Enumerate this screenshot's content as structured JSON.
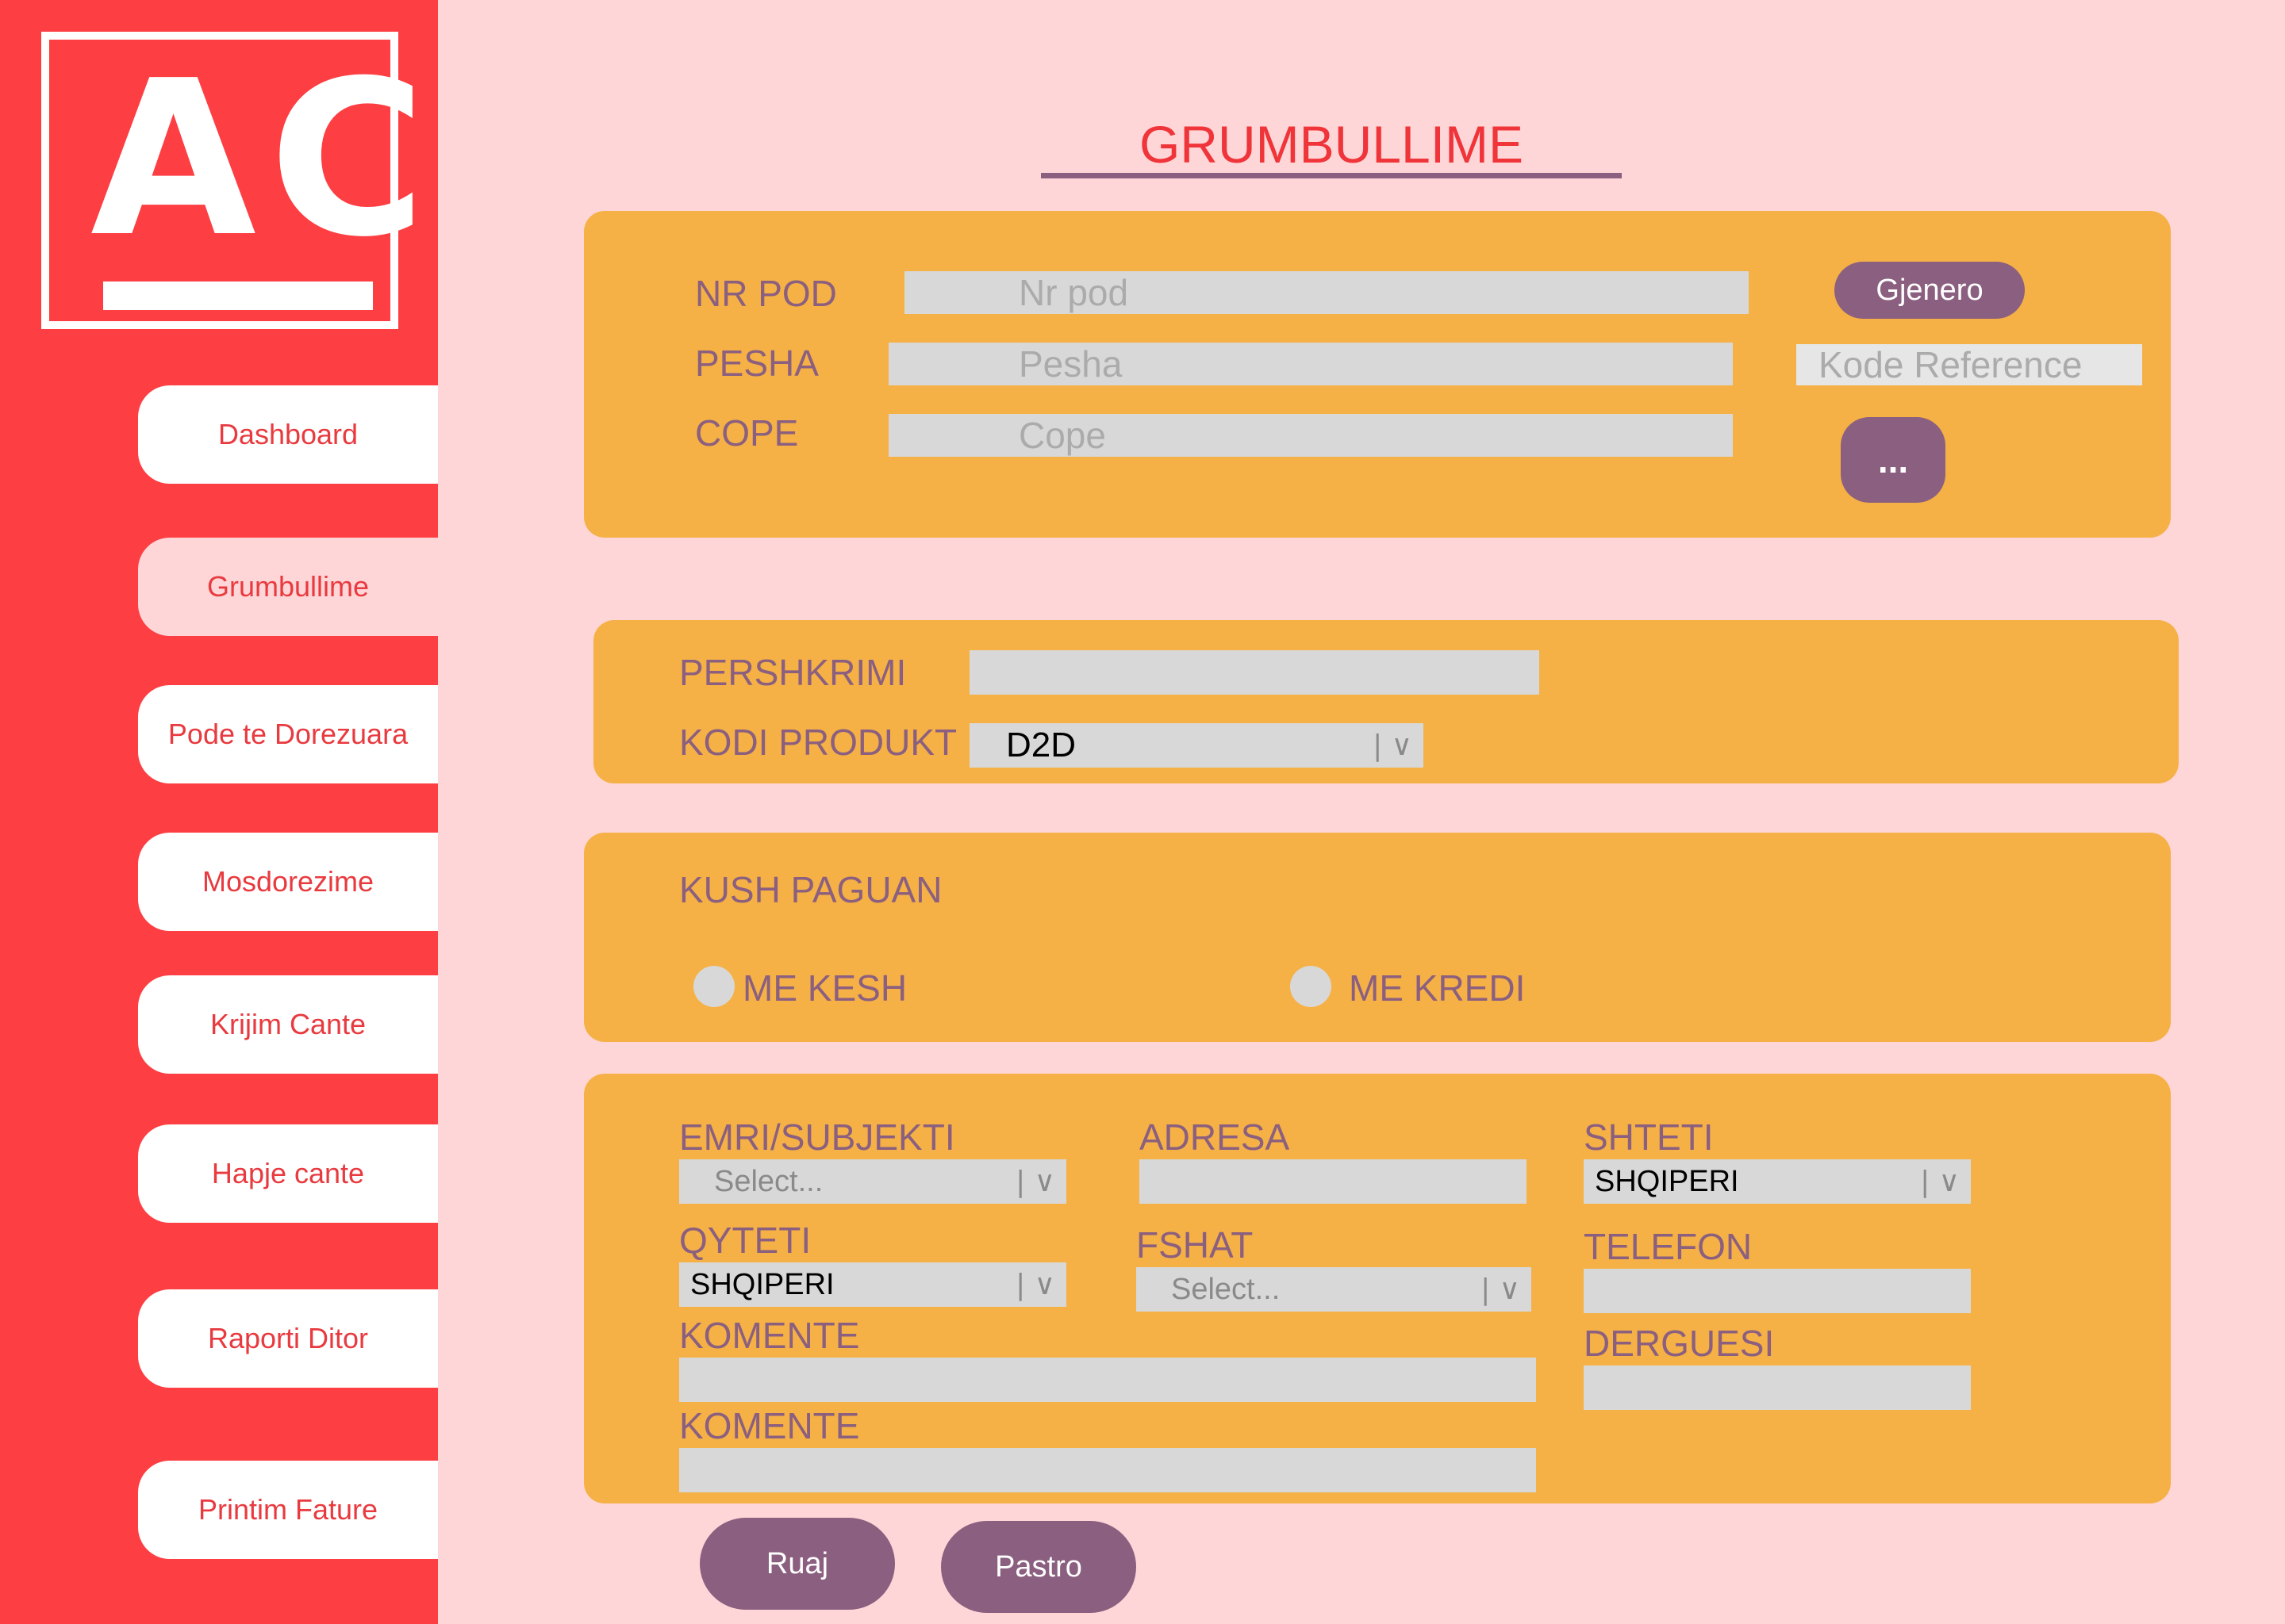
{
  "logo": {
    "text": "AC"
  },
  "sidebar": {
    "items": [
      {
        "label": "Dashboard"
      },
      {
        "label": "Grumbullime"
      },
      {
        "label": "Pode te Dorezuara"
      },
      {
        "label": "Mosdorezime"
      },
      {
        "label": "Krijim Cante"
      },
      {
        "label": "Hapje cante"
      },
      {
        "label": "Raporti Ditor"
      },
      {
        "label": "Printim Fature"
      }
    ],
    "active_index": 1
  },
  "page_title": "GRUMBULLIME",
  "section1": {
    "nr_pod_label": "NR POD",
    "nr_pod_placeholder": "Nr pod",
    "pesha_label": "PESHA",
    "pesha_placeholder": "Pesha",
    "cope_label": "COPE",
    "cope_placeholder": "Cope",
    "kode_reference_placeholder": "Kode Reference",
    "generate_button": "Gjenero",
    "more_button": "..."
  },
  "section2": {
    "pershkrimi_label": "PERSHKRIMI",
    "pershkrimi_value": "",
    "kodi_produkt_label": "KODI PRODUKT",
    "kodi_produkt_value": "D2D"
  },
  "section3": {
    "label": "KUSH PAGUAN",
    "option_cash": "ME KESH",
    "option_credit": "ME KREDI",
    "selected": ""
  },
  "section4": {
    "emri_label": "EMRI/SUBJEKTI",
    "emri_value": "Select...",
    "adresa_label": "ADRESA",
    "adresa_value": "",
    "shteti_label": "SHTETI",
    "shteti_value": "SHQIPERI",
    "qyteti_label": "QYTETI",
    "qyteti_value": "SHQIPERI",
    "fshat_label": "FSHAT",
    "fshat_value": "Select...",
    "telefon_label": "TELEFON",
    "telefon_value": "",
    "komente1_label": "KOMENTE",
    "komente1_value": "",
    "derguesi_label": "DERGUESI",
    "derguesi_value": "",
    "komente2_label": "KOMENTE",
    "komente2_value": ""
  },
  "select_arrow": "| ∨",
  "actions": {
    "save": "Ruaj",
    "clear": "Pastro"
  },
  "colors": {
    "background": "#ffd6d8",
    "sidebar": "#fd3e42",
    "panel": "#f5b146",
    "accent": "#8b5f7f",
    "field": "#d8d8d8",
    "title": "#f0353a"
  }
}
